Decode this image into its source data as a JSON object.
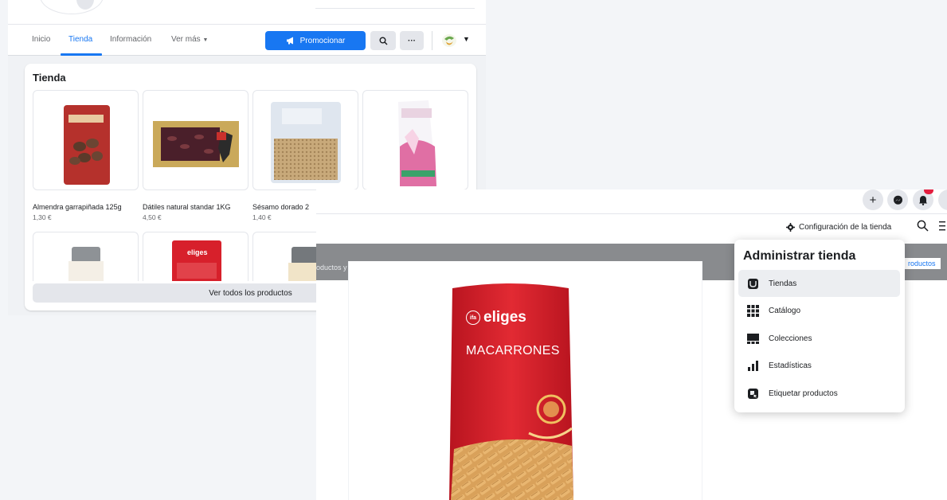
{
  "back_window": {
    "nav": {
      "tabs": [
        {
          "label": "Inicio"
        },
        {
          "label": "Tienda"
        },
        {
          "label": "Información"
        },
        {
          "label": "Ver más"
        }
      ],
      "promote_button": "Promocionar"
    },
    "shop": {
      "title": "Tienda",
      "products": [
        {
          "name": "Almendra garrapiñada 125g",
          "price": "1,30 €"
        },
        {
          "name": "Dátiles natural standar 1KG",
          "price": "4,50 €"
        },
        {
          "name": "Sésamo dorado 2",
          "price": "1,40 €"
        },
        {
          "name": "",
          "price": ""
        }
      ],
      "second_row_labels": [
        "eliges"
      ],
      "view_all_button": "Ver todos los productos"
    }
  },
  "front_window": {
    "config_link": "Configuración de la tienda",
    "band_text": "oductos y mantener la tienda activa.",
    "band_link": "roductos",
    "product_preview": {
      "brand": "eliges",
      "brand_badge": "ifa",
      "product_name": "MACARRONES"
    },
    "dropdown": {
      "title": "Administrar tienda",
      "items": [
        {
          "label": "Tiendas",
          "icon": "store-icon",
          "active": true
        },
        {
          "label": "Catálogo",
          "icon": "grid-icon",
          "active": false
        },
        {
          "label": "Colecciones",
          "icon": "collections-icon",
          "active": false
        },
        {
          "label": "Estadísticas",
          "icon": "bar-chart-icon",
          "active": false
        },
        {
          "label": "Etiquetar productos",
          "icon": "tag-products-icon",
          "active": false
        }
      ]
    }
  },
  "colors": {
    "accent": "#1877f2",
    "band_gray": "#898b8e",
    "pasta_red": "#d7202b"
  }
}
